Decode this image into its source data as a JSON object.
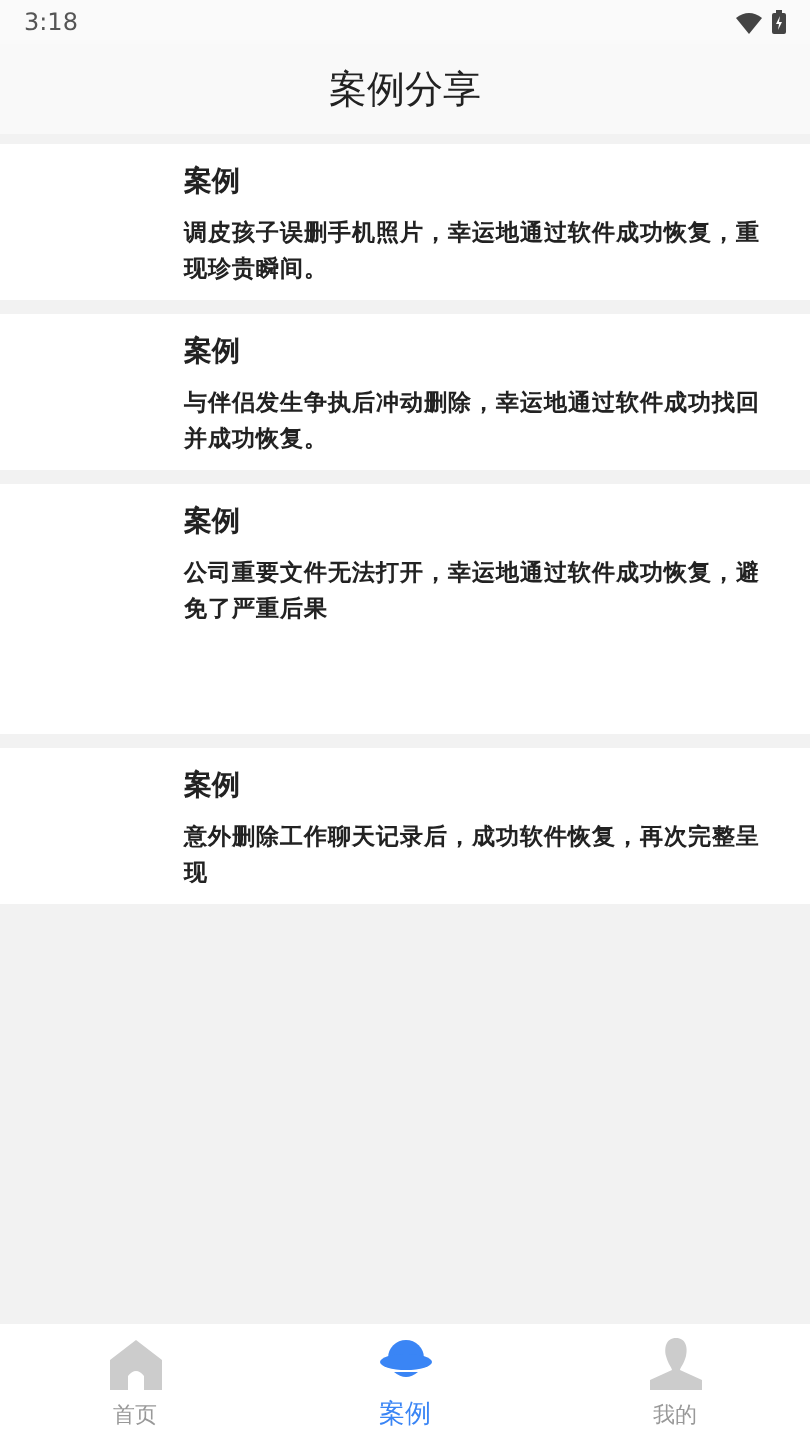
{
  "status_bar": {
    "time": "3:18"
  },
  "header": {
    "title": "案例分享"
  },
  "cases": [
    {
      "title": "案例",
      "text": "调皮孩子误删手机照片，幸运地通过软件成功恢复，重现珍贵瞬间。"
    },
    {
      "title": "案例",
      "text": "与伴侣发生争执后冲动删除，幸运地通过软件成功找回并成功恢复。"
    },
    {
      "title": "案例",
      "text": "公司重要文件无法打开，幸运地通过软件成功恢复，避免了严重后果"
    },
    {
      "title": "案例",
      "text": "意外删除工作聊天记录后，成功软件恢复，再次完整呈现"
    }
  ],
  "tab_bar": [
    {
      "kind": "home",
      "label": "首页",
      "selected": false
    },
    {
      "kind": "planet",
      "label": "案例",
      "selected": true
    },
    {
      "kind": "person",
      "label": "我的",
      "selected": false
    }
  ]
}
